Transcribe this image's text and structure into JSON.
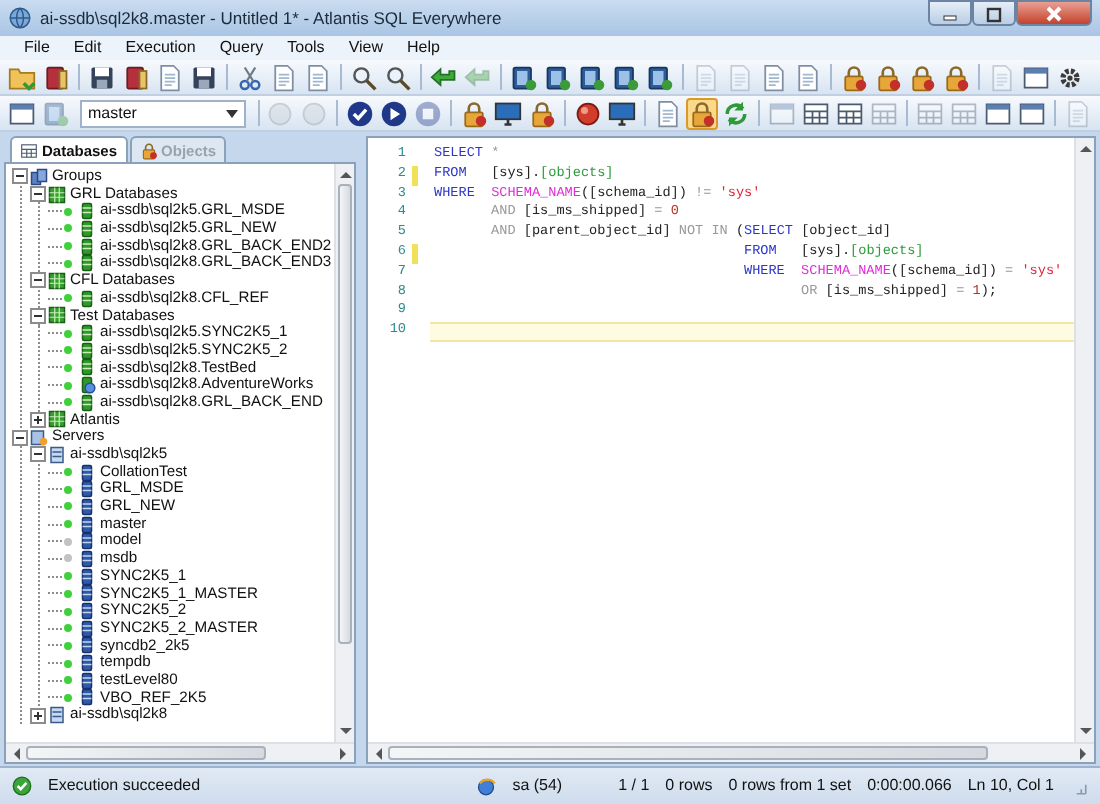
{
  "window": {
    "title": "ai-ssdb\\sql2k8.master - Untitled 1* - Atlantis SQL Everywhere"
  },
  "menu": [
    {
      "label": "File"
    },
    {
      "label": "Edit"
    },
    {
      "label": "Execution"
    },
    {
      "label": "Query"
    },
    {
      "label": "Tools"
    },
    {
      "label": "View"
    },
    {
      "label": "Help"
    }
  ],
  "toolbars": [
    {
      "items": [
        {
          "kind": "folder",
          "disabled": false,
          "pressed": false
        },
        {
          "kind": "book",
          "disabled": false,
          "pressed": false
        },
        {
          "kind": "separator"
        },
        {
          "kind": "disk",
          "disabled": false,
          "pressed": false
        },
        {
          "kind": "book",
          "disabled": false,
          "pressed": false
        },
        {
          "kind": "page",
          "disabled": false,
          "pressed": false
        },
        {
          "kind": "disk",
          "disabled": false,
          "pressed": false
        },
        {
          "kind": "separator"
        },
        {
          "kind": "scissors",
          "disabled": false,
          "pressed": false
        },
        {
          "kind": "page",
          "disabled": false,
          "pressed": false
        },
        {
          "kind": "page",
          "disabled": false,
          "pressed": false
        },
        {
          "kind": "separator"
        },
        {
          "kind": "magnifier",
          "disabled": false,
          "pressed": false
        },
        {
          "kind": "magnifier",
          "disabled": false,
          "pressed": false
        },
        {
          "kind": "separator"
        },
        {
          "kind": "arrow",
          "disabled": false,
          "pressed": false
        },
        {
          "kind": "arrow",
          "disabled": true,
          "pressed": false
        },
        {
          "kind": "separator"
        },
        {
          "kind": "db",
          "disabled": false,
          "pressed": false
        },
        {
          "kind": "db",
          "disabled": false,
          "pressed": false
        },
        {
          "kind": "db",
          "disabled": false,
          "pressed": false
        },
        {
          "kind": "db",
          "disabled": false,
          "pressed": false
        },
        {
          "kind": "db",
          "disabled": false,
          "pressed": false
        },
        {
          "kind": "separator"
        },
        {
          "kind": "page",
          "disabled": true,
          "pressed": false
        },
        {
          "kind": "page",
          "disabled": true,
          "pressed": false
        },
        {
          "kind": "page",
          "disabled": false,
          "pressed": false
        },
        {
          "kind": "page",
          "disabled": false,
          "pressed": false
        },
        {
          "kind": "separator"
        },
        {
          "kind": "lock",
          "disabled": false,
          "pressed": false
        },
        {
          "kind": "lock",
          "disabled": false,
          "pressed": false
        },
        {
          "kind": "lock",
          "disabled": false,
          "pressed": false
        },
        {
          "kind": "lock",
          "disabled": false,
          "pressed": false
        },
        {
          "kind": "separator"
        },
        {
          "kind": "page",
          "disabled": true,
          "pressed": false
        },
        {
          "kind": "window",
          "disabled": false,
          "pressed": false
        },
        {
          "kind": "gear",
          "disabled": false,
          "pressed": false
        }
      ]
    },
    {
      "items": [
        {
          "kind": "window",
          "disabled": false,
          "pressed": false
        },
        {
          "kind": "db",
          "disabled": true,
          "pressed": false
        },
        {
          "kind": "combo",
          "value": "master"
        },
        {
          "kind": "separator"
        },
        {
          "kind": "round",
          "disabled": true,
          "pressed": false
        },
        {
          "kind": "round",
          "disabled": true,
          "pressed": false
        },
        {
          "kind": "separator"
        },
        {
          "kind": "check",
          "disabled": false,
          "pressed": false
        },
        {
          "kind": "play",
          "disabled": false,
          "pressed": false
        },
        {
          "kind": "stop",
          "disabled": true,
          "pressed": false
        },
        {
          "kind": "separator"
        },
        {
          "kind": "lock",
          "disabled": false,
          "pressed": false
        },
        {
          "kind": "monitor",
          "disabled": false,
          "pressed": false
        },
        {
          "kind": "lock",
          "disabled": false,
          "pressed": false
        },
        {
          "kind": "separator"
        },
        {
          "kind": "ball",
          "disabled": false,
          "pressed": false
        },
        {
          "kind": "monitor",
          "disabled": false,
          "pressed": false
        },
        {
          "kind": "separator"
        },
        {
          "kind": "page",
          "disabled": false,
          "pressed": false
        },
        {
          "kind": "lock",
          "disabled": false,
          "pressed": true
        },
        {
          "kind": "refresh",
          "disabled": false,
          "pressed": false
        },
        {
          "kind": "separator"
        },
        {
          "kind": "window",
          "disabled": true,
          "pressed": false
        },
        {
          "kind": "grid",
          "disabled": false,
          "pressed": false
        },
        {
          "kind": "grid",
          "disabled": false,
          "pressed": false
        },
        {
          "kind": "grid",
          "disabled": true,
          "pressed": false
        },
        {
          "kind": "separator"
        },
        {
          "kind": "grid",
          "disabled": true,
          "pressed": false
        },
        {
          "kind": "grid",
          "disabled": true,
          "pressed": false
        },
        {
          "kind": "window",
          "disabled": false,
          "pressed": false
        },
        {
          "kind": "window",
          "disabled": false,
          "pressed": false
        },
        {
          "kind": "separator"
        },
        {
          "kind": "page",
          "disabled": true,
          "pressed": false
        }
      ]
    }
  ],
  "sidebar": {
    "tabs": [
      {
        "label": "Databases",
        "kind": "grid",
        "selected": true
      },
      {
        "label": "Objects",
        "kind": "lock",
        "selected": false
      }
    ],
    "tree": [
      {
        "label": "Groups",
        "kind": "groups",
        "expanded": true,
        "children": [
          {
            "label": "GRL Databases",
            "kind": "group",
            "expanded": true,
            "children": [
              {
                "label": "ai-ssdb\\sql2k5.GRL_MSDE",
                "kind": "database",
                "connected": true
              },
              {
                "label": "ai-ssdb\\sql2k5.GRL_NEW",
                "kind": "database",
                "connected": true
              },
              {
                "label": "ai-ssdb\\sql2k8.GRL_BACK_END2",
                "kind": "database",
                "connected": true
              },
              {
                "label": "ai-ssdb\\sql2k8.GRL_BACK_END3",
                "kind": "database",
                "connected": true
              }
            ]
          },
          {
            "label": "CFL Databases",
            "kind": "group",
            "expanded": true,
            "children": [
              {
                "label": "ai-ssdb\\sql2k8.CFL_REF",
                "kind": "database",
                "connected": true
              }
            ]
          },
          {
            "label": "Test Databases",
            "kind": "group",
            "expanded": true,
            "children": [
              {
                "label": "ai-ssdb\\sql2k5.SYNC2K5_1",
                "kind": "database",
                "connected": true
              },
              {
                "label": "ai-ssdb\\sql2k5.SYNC2K5_2",
                "kind": "database",
                "connected": true
              },
              {
                "label": "ai-ssdb\\sql2k8.TestBed",
                "kind": "database",
                "connected": true
              },
              {
                "label": "ai-ssdb\\sql2k8.AdventureWorks",
                "kind": "linked",
                "connected": true
              },
              {
                "label": "ai-ssdb\\sql2k8.GRL_BACK_END",
                "kind": "database",
                "connected": true
              }
            ]
          },
          {
            "label": "Atlantis",
            "kind": "group",
            "expanded": false
          }
        ]
      },
      {
        "label": "Servers",
        "kind": "servers",
        "expanded": true,
        "children": [
          {
            "label": "ai-ssdb\\sql2k5",
            "kind": "server",
            "expanded": true,
            "children": [
              {
                "label": "CollationTest",
                "kind": "catalog",
                "connected": true
              },
              {
                "label": "GRL_MSDE",
                "kind": "catalog",
                "connected": true
              },
              {
                "label": "GRL_NEW",
                "kind": "catalog",
                "connected": true
              },
              {
                "label": "master",
                "kind": "catalog",
                "connected": true
              },
              {
                "label": "model",
                "kind": "catalog",
                "connected": false
              },
              {
                "label": "msdb",
                "kind": "catalog",
                "connected": false
              },
              {
                "label": "SYNC2K5_1",
                "kind": "catalog",
                "connected": true
              },
              {
                "label": "SYNC2K5_1_MASTER",
                "kind": "catalog",
                "connected": true
              },
              {
                "label": "SYNC2K5_2",
                "kind": "catalog",
                "connected": true
              },
              {
                "label": "SYNC2K5_2_MASTER",
                "kind": "catalog",
                "connected": true
              },
              {
                "label": "syncdb2_2k5",
                "kind": "catalog",
                "connected": true
              },
              {
                "label": "tempdb",
                "kind": "catalog",
                "connected": true
              },
              {
                "label": "testLevel80",
                "kind": "catalog",
                "connected": true
              },
              {
                "label": "VBO_REF_2K5",
                "kind": "catalog",
                "connected": true
              }
            ]
          },
          {
            "label": "ai-ssdb\\sql2k8",
            "kind": "server",
            "expanded": false
          }
        ]
      }
    ]
  },
  "editor": {
    "lines": [
      {
        "number": "1",
        "modified": false,
        "current": false,
        "tokens": [
          {
            "text": "SELECT ",
            "kind": "keyword"
          },
          {
            "text": "*",
            "kind": "operator"
          }
        ]
      },
      {
        "number": "2",
        "modified": true,
        "current": false,
        "tokens": [
          {
            "text": "FROM   ",
            "kind": "keyword"
          },
          {
            "text": "[sys].",
            "kind": "identifier"
          },
          {
            "text": "[objects]",
            "kind": "table"
          }
        ]
      },
      {
        "number": "3",
        "modified": false,
        "current": false,
        "tokens": [
          {
            "text": "WHERE  ",
            "kind": "keyword"
          },
          {
            "text": "SCHEMA_NAME",
            "kind": "function"
          },
          {
            "text": "([schema_id]) ",
            "kind": "identifier"
          },
          {
            "text": "!= ",
            "kind": "operator"
          },
          {
            "text": "'sys'",
            "kind": "string"
          }
        ]
      },
      {
        "number": "4",
        "modified": false,
        "current": false,
        "tokens": [
          {
            "text": "       AND ",
            "kind": "operator"
          },
          {
            "text": "[is_ms_shipped] ",
            "kind": "identifier"
          },
          {
            "text": "= ",
            "kind": "operator"
          },
          {
            "text": "0",
            "kind": "number"
          }
        ]
      },
      {
        "number": "5",
        "modified": false,
        "current": false,
        "tokens": [
          {
            "text": "       AND ",
            "kind": "operator"
          },
          {
            "text": "[parent_object_id] ",
            "kind": "identifier"
          },
          {
            "text": "NOT IN ",
            "kind": "operator"
          },
          {
            "text": "(",
            "kind": "identifier"
          },
          {
            "text": "SELECT ",
            "kind": "keyword"
          },
          {
            "text": "[object_id]",
            "kind": "identifier"
          }
        ]
      },
      {
        "number": "6",
        "modified": true,
        "current": false,
        "tokens": [
          {
            "text": "                                      FROM   ",
            "kind": "keyword"
          },
          {
            "text": "[sys].",
            "kind": "identifier"
          },
          {
            "text": "[objects]",
            "kind": "table"
          }
        ]
      },
      {
        "number": "7",
        "modified": false,
        "current": false,
        "tokens": [
          {
            "text": "                                      WHERE  ",
            "kind": "keyword"
          },
          {
            "text": "SCHEMA_NAME",
            "kind": "function"
          },
          {
            "text": "([schema_id]) ",
            "kind": "identifier"
          },
          {
            "text": "= ",
            "kind": "operator"
          },
          {
            "text": "'sys'",
            "kind": "string"
          }
        ]
      },
      {
        "number": "8",
        "modified": false,
        "current": false,
        "tokens": [
          {
            "text": "                                             OR ",
            "kind": "operator"
          },
          {
            "text": "[is_ms_shipped] ",
            "kind": "identifier"
          },
          {
            "text": "= ",
            "kind": "operator"
          },
          {
            "text": "1",
            "kind": "number"
          },
          {
            "text": ");",
            "kind": "identifier"
          }
        ]
      },
      {
        "number": "9",
        "modified": false,
        "current": false
      },
      {
        "number": "10",
        "modified": false,
        "current": true
      }
    ]
  },
  "status_bar": {
    "message": "Execution succeeded",
    "session": "sa (54)",
    "fields": [
      "1 / 1",
      "0 rows",
      "0 rows from 1 set",
      "0:00:00.066",
      "Ln 10, Col 1"
    ]
  }
}
